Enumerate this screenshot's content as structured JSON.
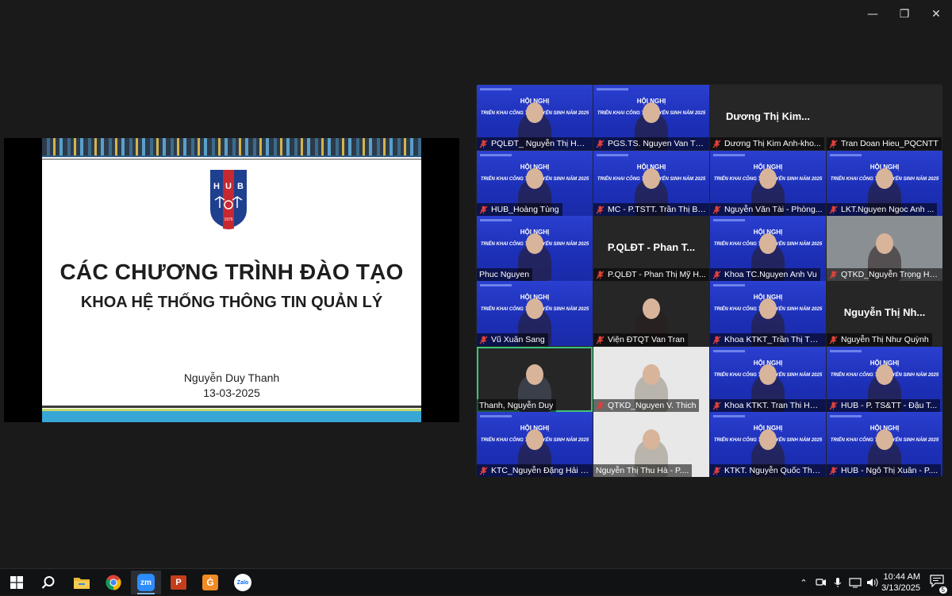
{
  "window": {
    "minimize_glyph": "—",
    "restore_glyph": "❐",
    "close_glyph": "✕"
  },
  "slide": {
    "logo_text": "HUB",
    "logo_year": "1976",
    "title": "CÁC CHƯƠNG TRÌNH ĐÀO TẠO",
    "subtitle": "KHOA HỆ THỐNG THÔNG TIN QUẢN LÝ",
    "presenter": "Nguyễn Duy Thanh",
    "date": "13-03-2025"
  },
  "banner": {
    "line1": "HỘI NGHỊ",
    "line2": "TRIỂN KHAI CÔNG TÁC TUYỂN SINH NĂM 2025"
  },
  "participants": [
    {
      "name": "PQLĐT_ Nguyễn Thị Huỳ...",
      "style": "banner",
      "muted": true,
      "display": ""
    },
    {
      "name": "PGS.TS. Nguyen Van Thuy",
      "style": "banner",
      "muted": true,
      "display": ""
    },
    {
      "name": "Dương Thị Kim Anh-kho...",
      "style": "dark",
      "muted": true,
      "display": "Dương Thị Kim..."
    },
    {
      "name": "Tran Doan Hieu_PQCNTT",
      "style": "dark",
      "muted": true,
      "display": ""
    },
    {
      "name": "HUB_Hoàng Tùng",
      "style": "banner",
      "muted": true,
      "display": ""
    },
    {
      "name": "MC - P.TSTT. Trần Thị Bí...",
      "style": "banner",
      "muted": true,
      "display": ""
    },
    {
      "name": "Nguyễn Văn Tài - Phòng...",
      "style": "banner",
      "muted": true,
      "display": ""
    },
    {
      "name": "LKT.Nguyen Ngoc Anh ...",
      "style": "banner",
      "muted": true,
      "display": ""
    },
    {
      "name": "Phuc Nguyen",
      "style": "banner",
      "muted": false,
      "display": ""
    },
    {
      "name": "P.QLĐT - Phan Thị Mỹ H...",
      "style": "dark",
      "muted": true,
      "display": "P.QLĐT - Phan T..."
    },
    {
      "name": "Khoa TC.Nguyen Anh Vu",
      "style": "banner",
      "muted": true,
      "display": ""
    },
    {
      "name": "QTKD_Nguyễn Trọng Hư...",
      "style": "gray",
      "muted": true,
      "display": ""
    },
    {
      "name": "Vũ Xuân Sang",
      "style": "banner",
      "muted": true,
      "display": ""
    },
    {
      "name": "Viện ĐTQT Van Tran",
      "style": "dark",
      "muted": true,
      "display": ""
    },
    {
      "name": "Khoa KTKT_Trần Thị Thu...",
      "style": "banner",
      "muted": true,
      "display": ""
    },
    {
      "name": "Nguyễn Thị Như Quỳnh",
      "style": "dark",
      "muted": true,
      "display": "Nguyễn Thị Nh..."
    },
    {
      "name": "Thanh, Nguyễn Duy",
      "style": "dark",
      "muted": false,
      "display": ""
    },
    {
      "name": "QTKD_Nguyen V. Thich",
      "style": "white",
      "muted": true,
      "display": ""
    },
    {
      "name": "Khoa KTKT. Tran Thi Hai...",
      "style": "banner",
      "muted": true,
      "display": ""
    },
    {
      "name": "HUB - P. TS&TT - Đậu T...",
      "style": "banner",
      "muted": true,
      "display": ""
    },
    {
      "name": "KTC_Nguyễn Đặng Hải Y...",
      "style": "banner",
      "muted": true,
      "display": ""
    },
    {
      "name": "Nguyễn Thị Thu Hà - P....",
      "style": "white",
      "muted": false,
      "display": ""
    },
    {
      "name": "KTKT. Nguyễn Quốc Thắ...",
      "style": "banner",
      "muted": true,
      "display": ""
    },
    {
      "name": "HUB - Ngô Thị Xuân - P....",
      "style": "banner",
      "muted": true,
      "display": ""
    }
  ],
  "taskbar": {
    "apps": [
      "start",
      "search",
      "file-explorer",
      "chrome",
      "zoom",
      "powerpoint",
      "pdf-editor",
      "zalo"
    ],
    "zoom_label": "zm",
    "zalo_label": "Zalo",
    "time": "10:44 AM",
    "date": "3/13/2025",
    "notification_count": "5"
  },
  "colors": {
    "banner_blue": "#2034c4",
    "active_speaker": "#3ec27a",
    "muted_red": "#e0403a",
    "slide_accent": "#38a7d6"
  }
}
